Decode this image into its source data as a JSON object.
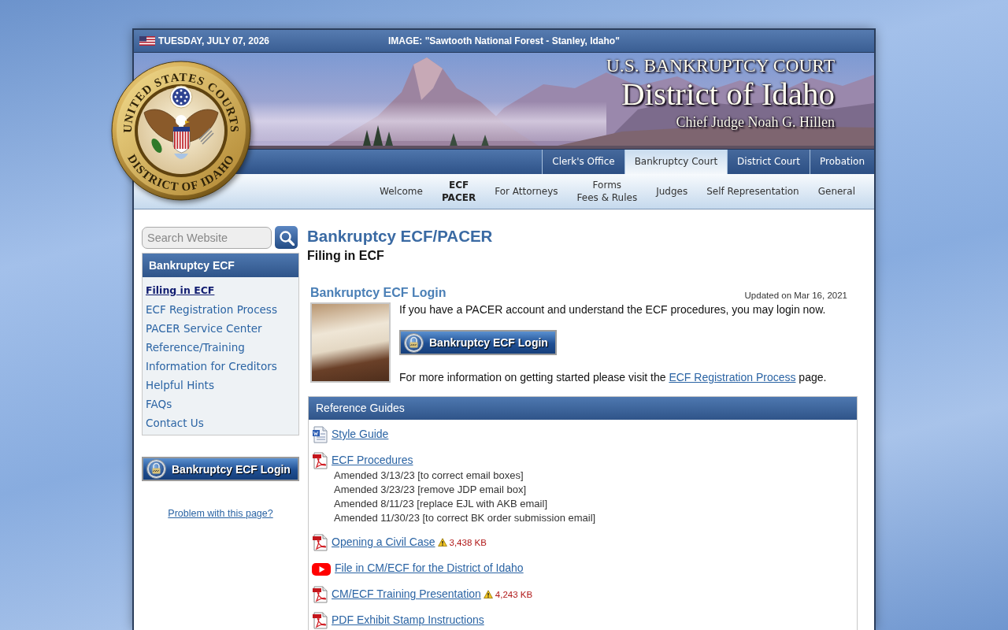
{
  "top_bar": {
    "date": "TUESDAY, JULY 07, 2026",
    "image_caption": "IMAGE: \"Sawtooth National Forest - Stanley, Idaho\""
  },
  "seal": {
    "top_text": "UNITED STATES COURTS",
    "bottom_text": "DISTRICT OF IDAHO"
  },
  "banner": {
    "court": "U.S. BANKRUPTCY COURT",
    "district": "District of Idaho",
    "judge": "Chief Judge Noah G. Hillen"
  },
  "tabs": [
    {
      "label": "Clerk's Office",
      "selected": false
    },
    {
      "label": "Bankruptcy Court",
      "selected": true
    },
    {
      "label": "District Court",
      "selected": false
    },
    {
      "label": "Probation",
      "selected": false
    }
  ],
  "subnav": [
    {
      "lines": [
        "Welcome"
      ],
      "selected": false
    },
    {
      "lines": [
        "ECF",
        "PACER"
      ],
      "selected": true
    },
    {
      "lines": [
        "For Attorneys"
      ],
      "selected": false
    },
    {
      "lines": [
        "Forms",
        "Fees & Rules"
      ],
      "selected": false
    },
    {
      "lines": [
        "Judges"
      ],
      "selected": false
    },
    {
      "lines": [
        "Self Representation"
      ],
      "selected": false
    },
    {
      "lines": [
        "General"
      ],
      "selected": false
    }
  ],
  "sidebar": {
    "search": {
      "placeholder": "Search Website"
    },
    "section_title": "Bankruptcy ECF",
    "items": [
      {
        "label": "Filing in ECF",
        "selected": true
      },
      {
        "label": "ECF Registration Process",
        "selected": false
      },
      {
        "label": "PACER Service Center",
        "selected": false
      },
      {
        "label": "Reference/Training",
        "selected": false
      },
      {
        "label": "Information for Creditors",
        "selected": false
      },
      {
        "label": "Helpful Hints",
        "selected": false
      },
      {
        "label": "FAQs",
        "selected": false
      },
      {
        "label": "Contact Us",
        "selected": false
      }
    ],
    "login_button": "Bankruptcy ECF Login",
    "problem_link": "Problem with this page?"
  },
  "main": {
    "title": "Bankruptcy ECF/PACER",
    "subtitle": "Filing in ECF",
    "login_section": {
      "title": "Bankruptcy ECF Login",
      "updated": "Updated on Mar 16, 2021",
      "intro": "If you have a PACER account and understand the ECF procedures, you may login now.",
      "button": "Bankruptcy ECF Login",
      "more_info": {
        "before": "For more information on getting started please visit the",
        "link": "ECF Registration Process",
        "after": "page."
      }
    },
    "reference_guides": {
      "title": "Reference Guides",
      "items": [
        {
          "kind": "word",
          "label": "Style Guide"
        },
        {
          "kind": "pdf",
          "label": "ECF Procedures",
          "notes": [
            "Amended 3/13/23 [to correct email boxes]",
            "Amended 3/23/23 [remove JDP email box]",
            "Amended 8/11/23 [replace EJL with AKB email]",
            "Amended 11/30/23 [to correct BK order submission email]"
          ]
        },
        {
          "kind": "pdf",
          "label": "Opening a Civil Case",
          "size": "3,438 KB"
        },
        {
          "kind": "video",
          "label": "File in CM/ECF for the District of Idaho"
        },
        {
          "kind": "pdf",
          "label": "CM/ECF Training Presentation",
          "size": "4,243 KB"
        },
        {
          "kind": "pdf",
          "label": "PDF Exhibit Stamp Instructions"
        }
      ]
    }
  }
}
